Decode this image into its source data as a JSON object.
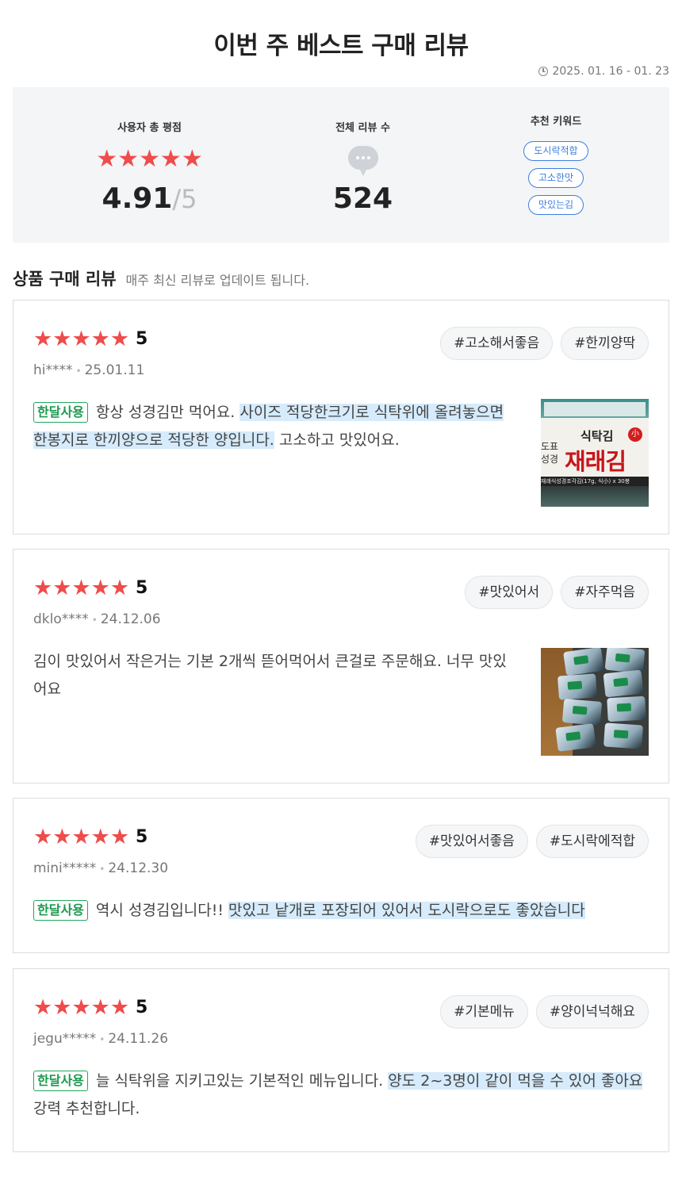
{
  "page": {
    "title": "이번 주 베스트 구매 리뷰",
    "date_range": "2025. 01. 16 - 01. 23"
  },
  "summary": {
    "rating_label": "사용자 총 평점",
    "rating_stars": "★★★★★",
    "rating_value": "4.91",
    "rating_max": "/5",
    "count_label": "전체 리뷰 수",
    "count_value": "524",
    "keywords_label": "추천 키워드",
    "keywords": [
      "도시락적합",
      "고소한맛",
      "맛있는김"
    ]
  },
  "section": {
    "title": "상품 구매 리뷰",
    "subtitle": "매주 최신 리뷰로 업데이트 됩니다."
  },
  "reviews": [
    {
      "stars": "★★★★★",
      "score": "5",
      "user": "hi****",
      "date": "25.01.11",
      "tags": [
        "#고소해서좋음",
        "#한끼양딱"
      ],
      "badge": "한달사용",
      "text_plain": "항상 성경김만 먹어요. ",
      "text_highlight": "사이즈 적당한크기로 식탁위에 올려놓으면 한봉지로 한끼양으로 적당한 양입니다.",
      "text_after": " 고소하고 맛있어요.",
      "image": {
        "brand_small": "식탁김",
        "brand_size": "小",
        "brand_name": "재래김",
        "side_text": "도표\n성경",
        "strip_text": "재래식성경조각김(17g, 식小) x 30봉"
      }
    },
    {
      "stars": "★★★★★",
      "score": "5",
      "user": "dklo****",
      "date": "24.12.06",
      "tags": [
        "#맛있어서",
        "#자주먹음"
      ],
      "badge": "",
      "text_plain": "김이 맛있어서 작은거는 기본 2개씩 뜯어먹어서 큰걸로 주문해요. 너무 맛있어요",
      "text_highlight": "",
      "text_after": ""
    },
    {
      "stars": "★★★★★",
      "score": "5",
      "user": "mini*****",
      "date": "24.12.30",
      "tags": [
        "#맛있어서좋음",
        "#도시락에적합"
      ],
      "badge": "한달사용",
      "text_plain": "역시 성경김입니다!! ",
      "text_highlight": "맛있고 낱개로 포장되어 있어서 도시락으로도 좋았습니다",
      "text_after": ""
    },
    {
      "stars": "★★★★★",
      "score": "5",
      "user": "jegu*****",
      "date": "24.11.26",
      "tags": [
        "#기본메뉴",
        "#양이넉넉해요"
      ],
      "badge": "한달사용",
      "text_plain": "늘 식탁위을 지키고있는 기본적인 메뉴입니다. ",
      "text_highlight": "양도 2~3명이 같이 먹을 수 있어 좋아요",
      "text_after": " 강력 추천합니다."
    }
  ],
  "colors": {
    "star": "#ef4c4c",
    "keyword_chip": "#3d7ee0",
    "badge": "#22a85a",
    "highlight": "#d6ebfb"
  },
  "icons": {
    "date": "clock-icon",
    "review_count": "speech-bubble-icon"
  }
}
